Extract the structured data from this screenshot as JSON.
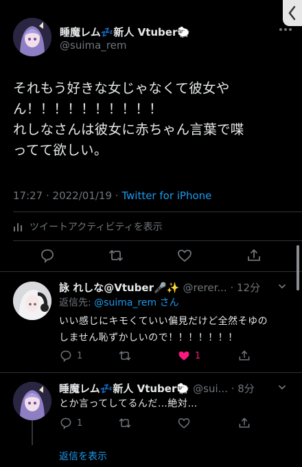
{
  "main_tweet": {
    "display_name": "睡魔レム💤新人 Vtuber🐑",
    "handle": "@suima_rem",
    "body_lines": [
      "それもう好きな女じゃなくて彼女や",
      "ん！！！！！！！！！！",
      "れしなさんは彼女に赤ちゃん言葉で喋",
      "ってて欲しい。"
    ],
    "time": "17:27",
    "date": "2022/01/19",
    "source": "Twitter for iPhone",
    "activity_label": "ツイートアクティビティを表示"
  },
  "replies": [
    {
      "display_name": "詠 れしな@Vtuber🎤✨",
      "handle": "@rerer...",
      "age": "12分",
      "reply_to_prefix": "返信先: ",
      "reply_to_handle": "@suima_rem",
      "reply_to_suffix": "さん",
      "text_lines": [
        "いい感じにキモくていい偏見だけど全然そゆの",
        "しません恥ずかしいので！！！！！！！"
      ],
      "reply_count": "1",
      "like_count": "1",
      "liked": true
    },
    {
      "display_name": "睡魔レム💤新人 Vtuber🐑",
      "handle": "@sui...",
      "age": "8分",
      "text_lines": [
        "とか言ってしてるんだ…絶対…"
      ],
      "reply_count": "1",
      "like_count": "",
      "liked": false
    }
  ],
  "show_replies_label": "返信を表示",
  "colors": {
    "accent": "#1d9bf0",
    "like": "#f91880",
    "muted": "#71767b",
    "text": "#e7e9ea"
  }
}
